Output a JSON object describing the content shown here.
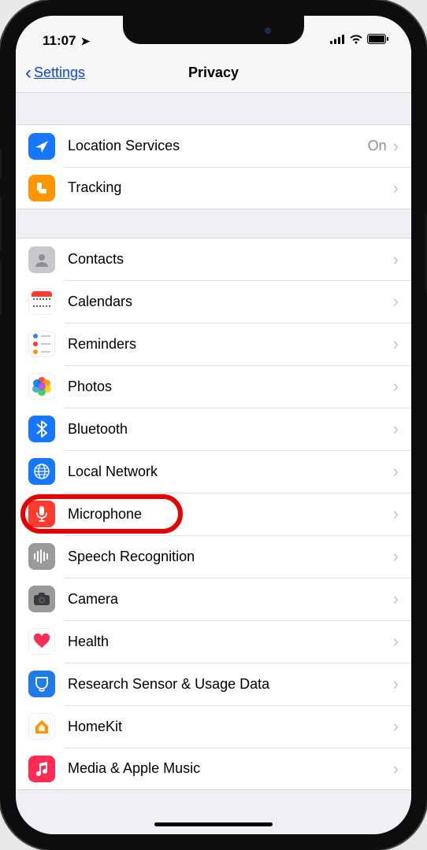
{
  "status": {
    "time": "11:07",
    "location_indicator": "➤"
  },
  "nav": {
    "back_label": "Settings",
    "title": "Privacy"
  },
  "groups": [
    {
      "cells": [
        {
          "key": "location",
          "label": "Location Services",
          "value": "On",
          "icon": "location-arrow-icon"
        },
        {
          "key": "tracking",
          "label": "Tracking",
          "icon": "tracking-icon"
        }
      ]
    },
    {
      "cells": [
        {
          "key": "contacts",
          "label": "Contacts",
          "icon": "contacts-icon"
        },
        {
          "key": "calendars",
          "label": "Calendars",
          "icon": "calendar-icon"
        },
        {
          "key": "reminders",
          "label": "Reminders",
          "icon": "reminders-icon"
        },
        {
          "key": "photos",
          "label": "Photos",
          "icon": "photos-icon"
        },
        {
          "key": "bluetooth",
          "label": "Bluetooth",
          "icon": "bluetooth-icon"
        },
        {
          "key": "localnet",
          "label": "Local Network",
          "icon": "globe-icon"
        },
        {
          "key": "microphone",
          "label": "Microphone",
          "icon": "microphone-icon",
          "highlighted": true
        },
        {
          "key": "speech",
          "label": "Speech Recognition",
          "icon": "waveform-icon"
        },
        {
          "key": "camera",
          "label": "Camera",
          "icon": "camera-icon"
        },
        {
          "key": "health",
          "label": "Health",
          "icon": "heart-icon"
        },
        {
          "key": "research",
          "label": "Research Sensor & Usage Data",
          "icon": "research-icon"
        },
        {
          "key": "homekit",
          "label": "HomeKit",
          "icon": "home-icon"
        },
        {
          "key": "music",
          "label": "Media & Apple Music",
          "icon": "music-icon"
        }
      ]
    }
  ]
}
